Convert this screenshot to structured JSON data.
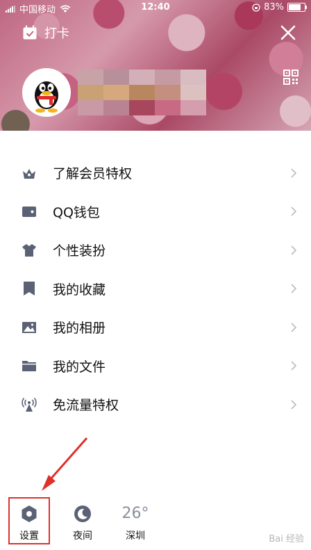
{
  "status_bar": {
    "carrier": "中国移动",
    "time": "12:40",
    "battery": "83%"
  },
  "header": {
    "checkin_label": "打卡"
  },
  "menu": {
    "items": [
      {
        "label": "了解会员特权",
        "icon": "crown-icon"
      },
      {
        "label": "QQ钱包",
        "icon": "wallet-icon"
      },
      {
        "label": "个性装扮",
        "icon": "shirt-icon"
      },
      {
        "label": "我的收藏",
        "icon": "bookmark-icon"
      },
      {
        "label": "我的相册",
        "icon": "photo-icon"
      },
      {
        "label": "我的文件",
        "icon": "folder-icon"
      },
      {
        "label": "免流量特权",
        "icon": "broadcast-icon"
      }
    ]
  },
  "bottom_bar": {
    "settings_label": "设置",
    "night_label": "夜间",
    "temperature": "26°",
    "city": "深圳"
  },
  "watermark": "Bai 经验",
  "colors": {
    "icon_gray": "#5b6275",
    "highlight_red": "#e0302c",
    "chevron_gray": "#b8bcc6"
  }
}
